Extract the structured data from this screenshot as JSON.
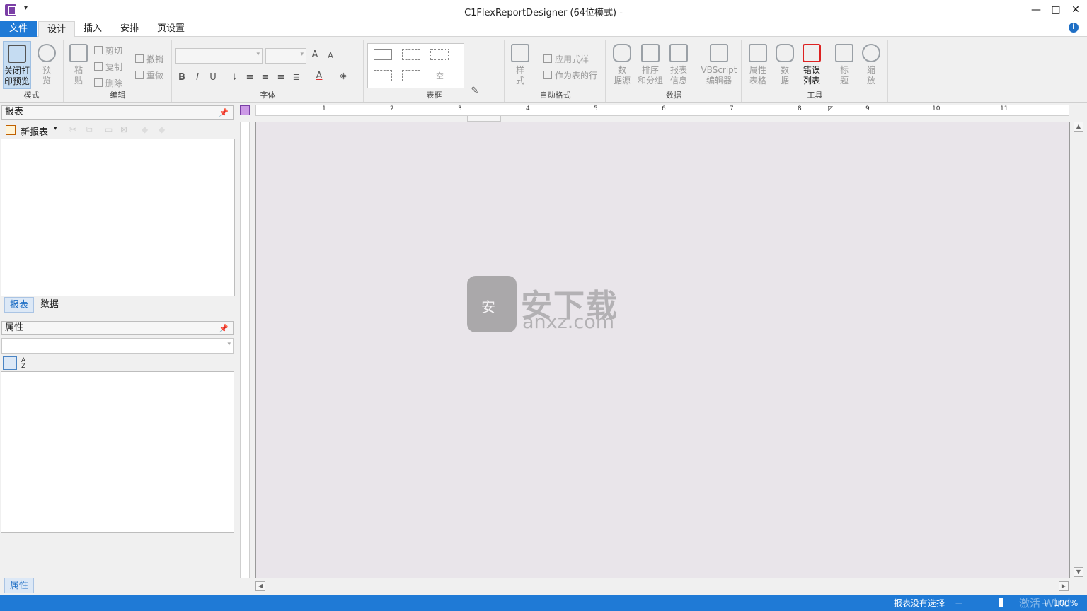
{
  "window": {
    "title": "C1FlexReportDesigner (64位模式) -",
    "qat_arrow": "▾",
    "minimize": "—",
    "maximize": "□",
    "close": "✕"
  },
  "menu": {
    "tabs": [
      "文件",
      "设计",
      "插入",
      "安排",
      "页设置"
    ],
    "info": "i"
  },
  "ribbon": {
    "mode": {
      "group": "模式",
      "close_preview": [
        "关闭打",
        "印预览"
      ],
      "preview": [
        "预",
        "览"
      ]
    },
    "edit": {
      "group": "编辑",
      "paste": [
        "粘",
        "贴"
      ],
      "cut": "剪切",
      "copy": "复制",
      "delete": "删除",
      "undo": "撤销",
      "redo": "重做"
    },
    "font": {
      "group": "字体",
      "bold": "B",
      "italic": "I",
      "underline": "U",
      "grow": "A",
      "shrink": "A"
    },
    "border": {
      "group": "表框",
      "empty": "空"
    },
    "autoformat": {
      "group": "自动格式",
      "style": [
        "样",
        "式"
      ],
      "apply_style": "应用式样",
      "as_table_row": "作为表的行"
    },
    "data": {
      "group": "数据",
      "datasource": [
        "数",
        "据源"
      ],
      "sort_group": [
        "排序",
        "和分组"
      ],
      "report_info": [
        "报表",
        "信息"
      ],
      "vbscript": [
        "VBScript",
        "编辑器"
      ]
    },
    "tools": {
      "group": "工具",
      "prop_table": [
        "属性",
        "表格"
      ],
      "data": [
        "数",
        "据"
      ],
      "error_list": [
        "错误",
        "列表"
      ],
      "title": [
        "标",
        "题"
      ],
      "zoom": [
        "缩",
        "放"
      ]
    }
  },
  "reports_panel": {
    "title": "报表",
    "new_report": "新报表",
    "tabs": [
      "报表",
      "数据"
    ]
  },
  "props_panel": {
    "title": "属性",
    "selected": "",
    "tab": "属性",
    "sort_label": "A Z"
  },
  "ruler": {
    "marks": [
      "1",
      "2",
      "3",
      "4",
      "5",
      "6",
      "7",
      "8",
      "9",
      "10",
      "11"
    ]
  },
  "watermark": {
    "cn": "安下载",
    "en": "anxz.com"
  },
  "status": {
    "selection": "报表没有选择",
    "zoom": "100%",
    "minus": "−",
    "plus": "+",
    "activate": "激活 Wind"
  }
}
